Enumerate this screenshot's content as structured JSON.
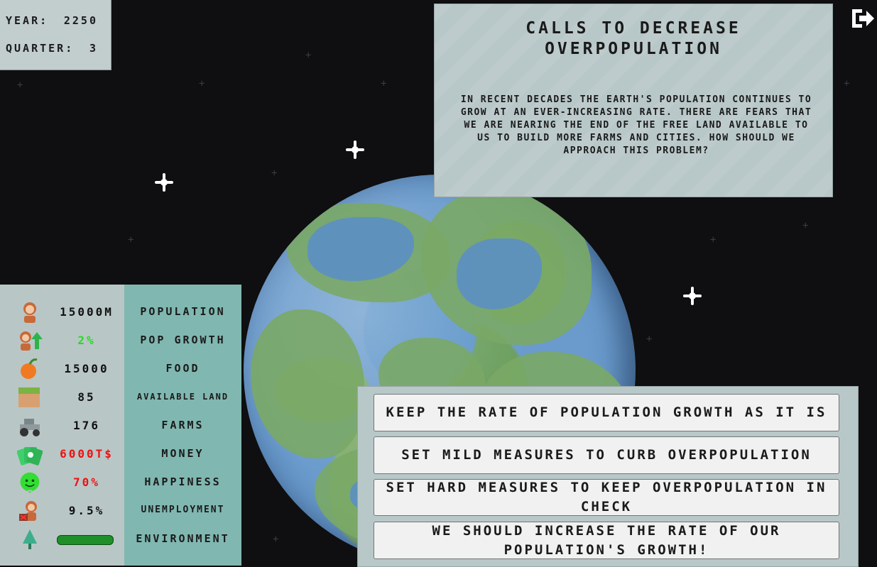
{
  "time": {
    "year_label": "YEAR:",
    "year_value": "2250",
    "quarter_label": "QUARTER:",
    "quarter_value": "3"
  },
  "event": {
    "title": "CALLS TO DECREASE OVERPOPULATION",
    "text": "IN RECENT DECADES THE EARTH'S POPULATION CONTINUES TO GROW AT AN EVER-INCREASING RATE. THERE ARE FEARS THAT WE ARE NEARING THE END OF THE FREE LAND AVAILABLE TO US TO BUILD MORE FARMS AND CITIES. HOW SHOULD WE APPROACH THIS PROBLEM?"
  },
  "stats": [
    {
      "icon": "population-icon",
      "value": "15000M",
      "label": "POPULATION",
      "color": "#111111"
    },
    {
      "icon": "pop-growth-icon",
      "value": "2%",
      "label": "POP GROWTH",
      "color": "#22dd22"
    },
    {
      "icon": "food-icon",
      "value": "15000",
      "label": "FOOD",
      "color": "#111111"
    },
    {
      "icon": "land-icon",
      "value": "85",
      "label": "AVAILABLE LAND",
      "color": "#111111"
    },
    {
      "icon": "tractor-icon",
      "value": "176",
      "label": "FARMS",
      "color": "#111111"
    },
    {
      "icon": "money-icon",
      "value": "6000T$",
      "label": "MONEY",
      "color": "#ee1111"
    },
    {
      "icon": "happiness-icon",
      "value": "70%",
      "label": "HAPPINESS",
      "color": "#ee1111"
    },
    {
      "icon": "unemployment-icon",
      "value": "9.5%",
      "label": "UNEMPLOYMENT",
      "color": "#111111"
    },
    {
      "icon": "tree-icon",
      "value": "",
      "label": "ENVIRONMENT",
      "color": "#1f8f2a",
      "level": 1.0
    }
  ],
  "choices": [
    "KEEP THE RATE OF POPULATION GROWTH AS IT IS",
    "SET MILD MEASURES TO CURB OVERPOPULATION",
    "SET HARD MEASURES TO KEEP OVERPOPULATION IN CHECK",
    "WE SHOULD INCREASE THE RATE OF OUR POPULATION'S GROWTH!"
  ]
}
